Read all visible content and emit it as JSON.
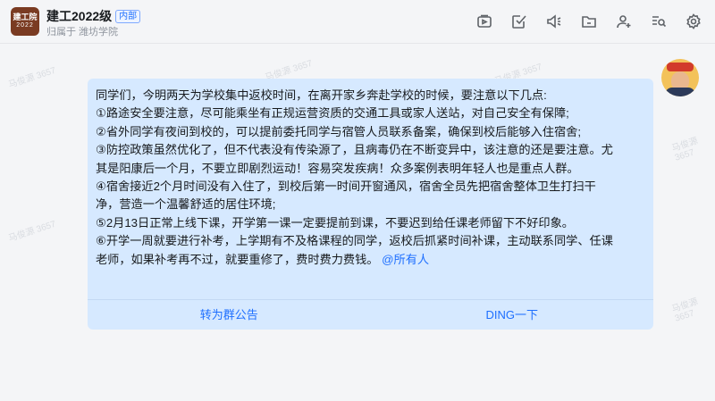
{
  "header": {
    "avatar_line1": "建工院",
    "avatar_line2": "2022",
    "title": "建工2022级",
    "badge": "内部",
    "subtitle": "归属于 潍坊学院",
    "toolbar_icons": [
      "video-icon",
      "task-check-icon",
      "announcement-icon",
      "folder-icon",
      "add-member-icon",
      "search-icon",
      "settings-icon"
    ]
  },
  "watermark": "马俊源 3657",
  "message": {
    "lines": [
      "同学们，今明两天为学校集中返校时间，在离开家乡奔赴学校的时候，要注意以下几点:",
      "①路途安全要注意，尽可能乘坐有正规运营资质的交通工具或家人送站，对自己安全有保障;",
      "②省外同学有夜间到校的，可以提前委托同学与宿管人员联系备案，确保到校后能够入住宿舍;",
      "③防控政策虽然优化了，但不代表没有传染源了，且病毒仍在不断变异中，该注意的还是要注意。尤",
      "其是阳康后一个月，不要立即剧烈运动！容易突发疾病！众多案例表明年轻人也是重点人群。",
      "④宿舍接近2个月时间没有入住了，到校后第一时间开窗通风，宿舍全员先把宿舍整体卫生打扫干",
      "净，营造一个温馨舒适的居住环境;",
      "⑤2月13日正常上线下课，开学第一课一定要提前到课，不要迟到给任课老师留下不好印象。",
      "⑥开学一周就要进行补考，上学期有不及格课程的同学，返校后抓紧时间补课，主动联系同学、任课",
      "老师，如果补考再不过，就要重修了，费时费力费钱。"
    ],
    "mention": "@所有人",
    "action_left": "转为群公告",
    "action_right": "DING一下"
  }
}
